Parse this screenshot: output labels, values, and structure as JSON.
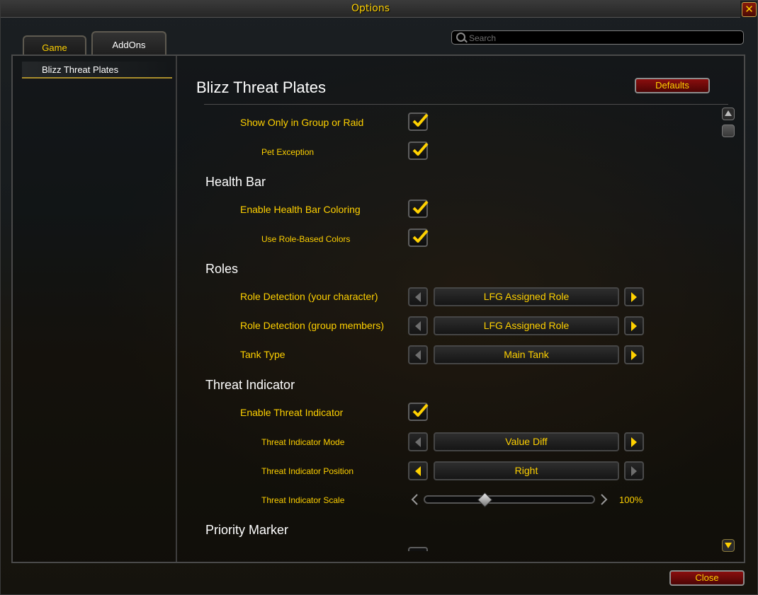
{
  "window": {
    "title": "Options",
    "close_glyph": "✕"
  },
  "tabs": [
    {
      "label": "Game",
      "active": false
    },
    {
      "label": "AddOns",
      "active": true
    }
  ],
  "search": {
    "placeholder": "Search",
    "value": ""
  },
  "sidebar": {
    "items": [
      {
        "label": "Blizz Threat Plates",
        "selected": true
      }
    ]
  },
  "main": {
    "title": "Blizz Threat Plates",
    "defaults_label": "Defaults",
    "settings": {
      "show_only_group_raid": {
        "label": "Show Only in Group or Raid",
        "checked": true
      },
      "pet_exception": {
        "label": "Pet Exception",
        "checked": true
      },
      "health_bar": {
        "heading": "Health Bar",
        "enable_coloring": {
          "label": "Enable Health Bar Coloring",
          "checked": true
        },
        "role_colors": {
          "label": "Use Role-Based Colors",
          "checked": true
        }
      },
      "roles": {
        "heading": "Roles",
        "detect_self": {
          "label": "Role Detection (your character)",
          "value": "LFG Assigned Role"
        },
        "detect_group": {
          "label": "Role Detection (group members)",
          "value": "LFG Assigned Role"
        },
        "tank_type": {
          "label": "Tank Type",
          "value": "Main Tank"
        }
      },
      "threat_indicator": {
        "heading": "Threat Indicator",
        "enable": {
          "label": "Enable Threat Indicator",
          "checked": true
        },
        "mode": {
          "label": "Threat Indicator Mode",
          "value": "Value Diff"
        },
        "position": {
          "label": "Threat Indicator Position",
          "value": "Right"
        },
        "scale": {
          "label": "Threat Indicator Scale",
          "value_text": "100%",
          "fraction": 0.34
        }
      },
      "priority_marker": {
        "heading": "Priority Marker"
      }
    }
  },
  "footer": {
    "close_label": "Close"
  },
  "colors": {
    "accent": "#ffd100",
    "heading": "#ffffff",
    "button_red": "#8a0e0e",
    "arrow_active": "#ffd100",
    "arrow_inactive": "#6e6e6e"
  },
  "icons": {
    "search": "search-icon",
    "check": "checkmark-icon",
    "arrow_left": "arrow-left-icon",
    "arrow_right": "arrow-right-icon",
    "scroll_up": "scroll-up-icon",
    "scroll_down": "scroll-down-icon",
    "close": "close-icon"
  }
}
